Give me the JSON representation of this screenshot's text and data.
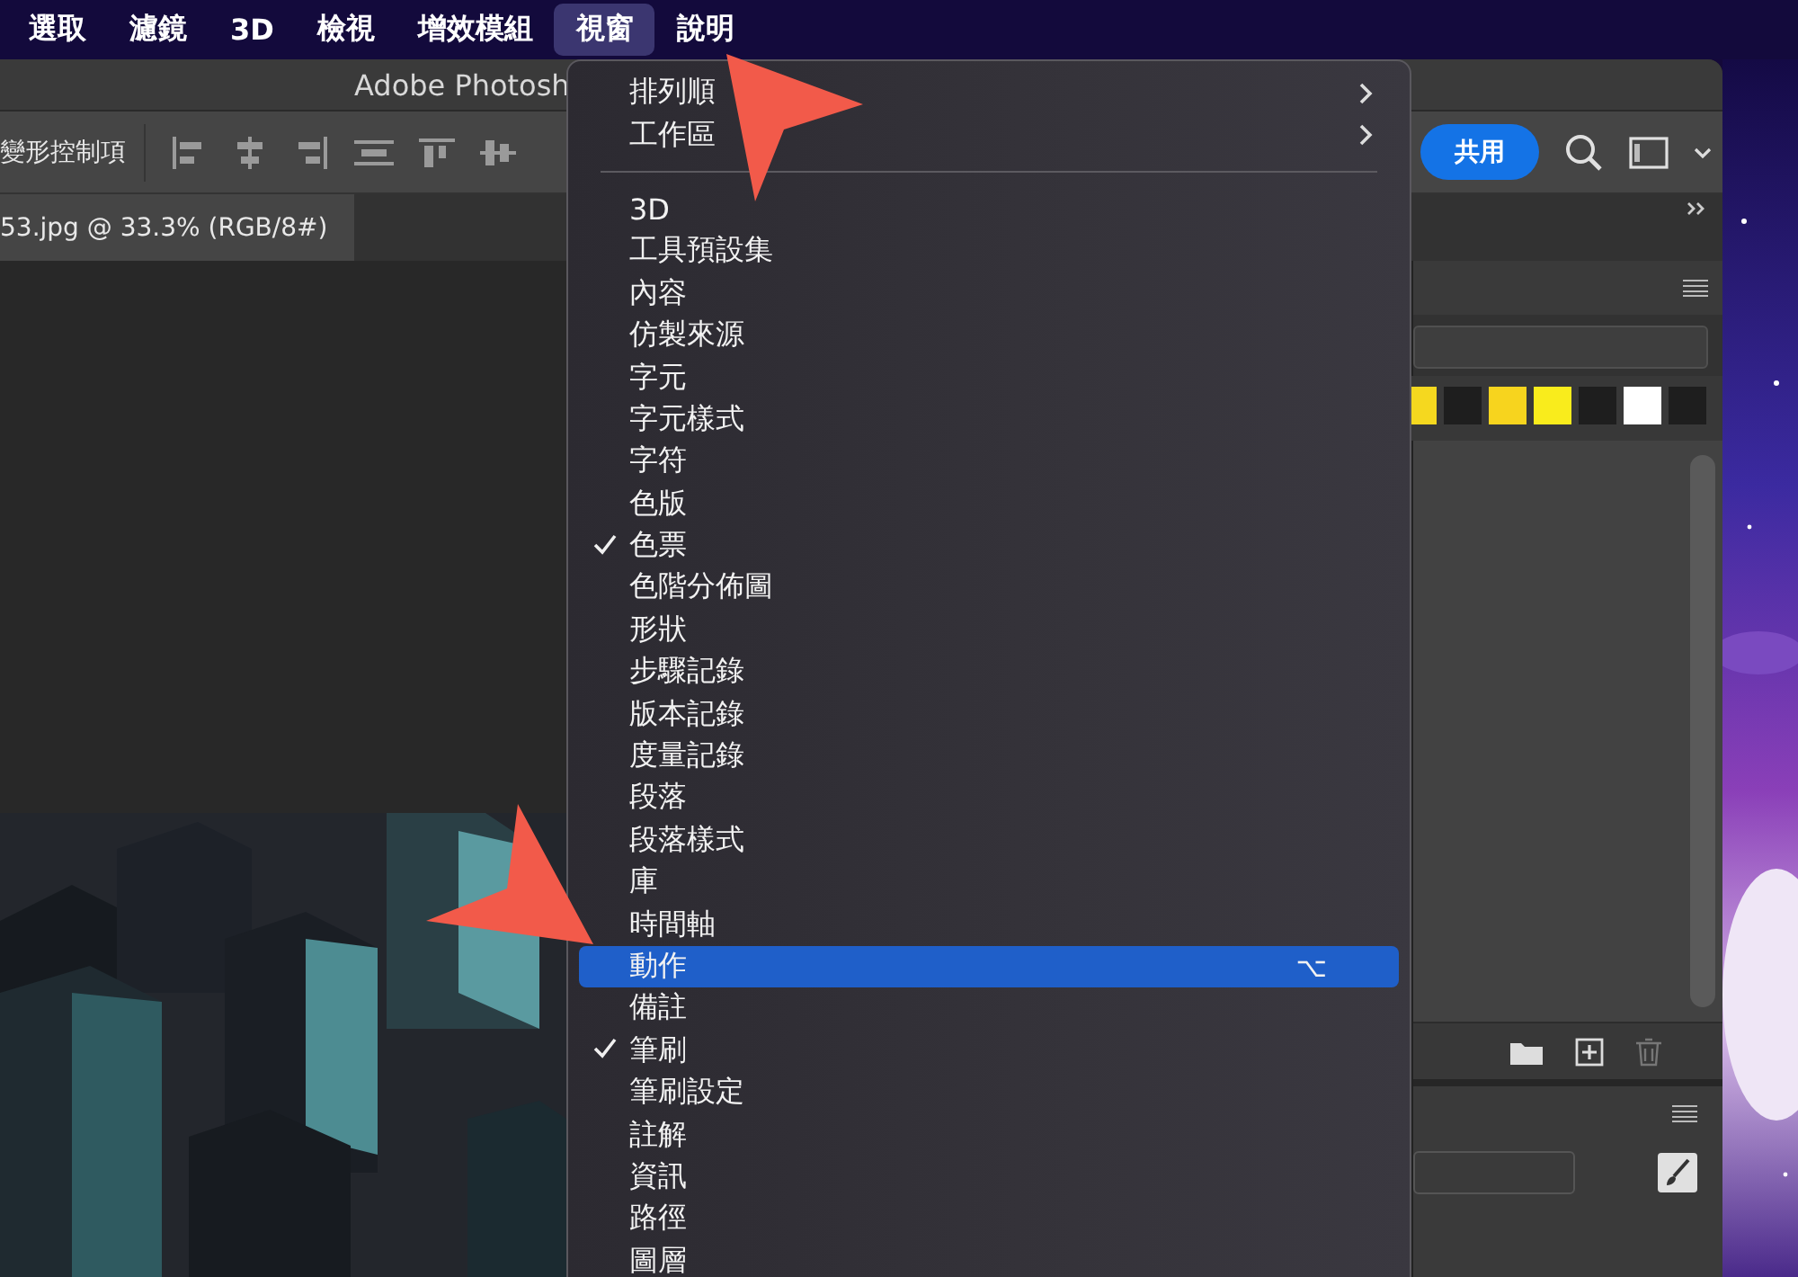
{
  "menu_bar": [
    {
      "label": "選取",
      "selected": false
    },
    {
      "label": "濾鏡",
      "selected": false
    },
    {
      "label": "3D",
      "selected": false
    },
    {
      "label": "檢視",
      "selected": false
    },
    {
      "label": "增效模組",
      "selected": false
    },
    {
      "label": "視窗",
      "selected": true
    },
    {
      "label": "說明",
      "selected": false
    }
  ],
  "window": {
    "title": "Adobe Photosh"
  },
  "options_bar": {
    "label": "變形控制項",
    "share_button": "共用"
  },
  "document_tab": {
    "label": "53.jpg @ 33.3% (RGB/8#)"
  },
  "swatches": [
    {
      "color": "#f5d81f"
    },
    {
      "color": "#1e1e1e"
    },
    {
      "color": "#f7d41e"
    },
    {
      "color": "#f9ec1c"
    },
    {
      "color": "#1e1e1e"
    },
    {
      "color": "#ffffff"
    },
    {
      "color": "#1e1e1e"
    }
  ],
  "window_menu": {
    "items": [
      {
        "kind": "submenu",
        "label": "排列順",
        "checked": false,
        "selected": false
      },
      {
        "kind": "submenu",
        "label": "工作區",
        "checked": false,
        "selected": false
      },
      {
        "kind": "separator"
      },
      {
        "kind": "item",
        "label": "3D",
        "checked": false,
        "selected": false
      },
      {
        "kind": "item",
        "label": "工具預設集",
        "checked": false,
        "selected": false
      },
      {
        "kind": "item",
        "label": "內容",
        "checked": false,
        "selected": false
      },
      {
        "kind": "item",
        "label": "仿製來源",
        "checked": false,
        "selected": false
      },
      {
        "kind": "item",
        "label": "字元",
        "checked": false,
        "selected": false
      },
      {
        "kind": "item",
        "label": "字元樣式",
        "checked": false,
        "selected": false
      },
      {
        "kind": "item",
        "label": "字符",
        "checked": false,
        "selected": false
      },
      {
        "kind": "item",
        "label": "色版",
        "checked": false,
        "selected": false
      },
      {
        "kind": "item",
        "label": "色票",
        "checked": true,
        "selected": false
      },
      {
        "kind": "item",
        "label": "色階分佈圖",
        "checked": false,
        "selected": false
      },
      {
        "kind": "item",
        "label": "形狀",
        "checked": false,
        "selected": false
      },
      {
        "kind": "item",
        "label": "步驟記錄",
        "checked": false,
        "selected": false
      },
      {
        "kind": "item",
        "label": "版本記錄",
        "checked": false,
        "selected": false
      },
      {
        "kind": "item",
        "label": "度量記錄",
        "checked": false,
        "selected": false
      },
      {
        "kind": "item",
        "label": "段落",
        "checked": false,
        "selected": false
      },
      {
        "kind": "item",
        "label": "段落樣式",
        "checked": false,
        "selected": false
      },
      {
        "kind": "item",
        "label": "庫",
        "checked": false,
        "selected": false
      },
      {
        "kind": "item",
        "label": "時間軸",
        "checked": false,
        "selected": false
      },
      {
        "kind": "item",
        "label": "動作",
        "checked": false,
        "selected": true,
        "shortcut": "⌥"
      },
      {
        "kind": "item",
        "label": "備註",
        "checked": false,
        "selected": false
      },
      {
        "kind": "item",
        "label": "筆刷",
        "checked": true,
        "selected": false
      },
      {
        "kind": "item",
        "label": "筆刷設定",
        "checked": false,
        "selected": false
      },
      {
        "kind": "item",
        "label": "註解",
        "checked": false,
        "selected": false
      },
      {
        "kind": "item",
        "label": "資訊",
        "checked": false,
        "selected": false
      },
      {
        "kind": "item",
        "label": "路徑",
        "checked": false,
        "selected": false
      },
      {
        "kind": "item",
        "label": "圖層",
        "checked": false,
        "selected": false
      }
    ]
  }
}
